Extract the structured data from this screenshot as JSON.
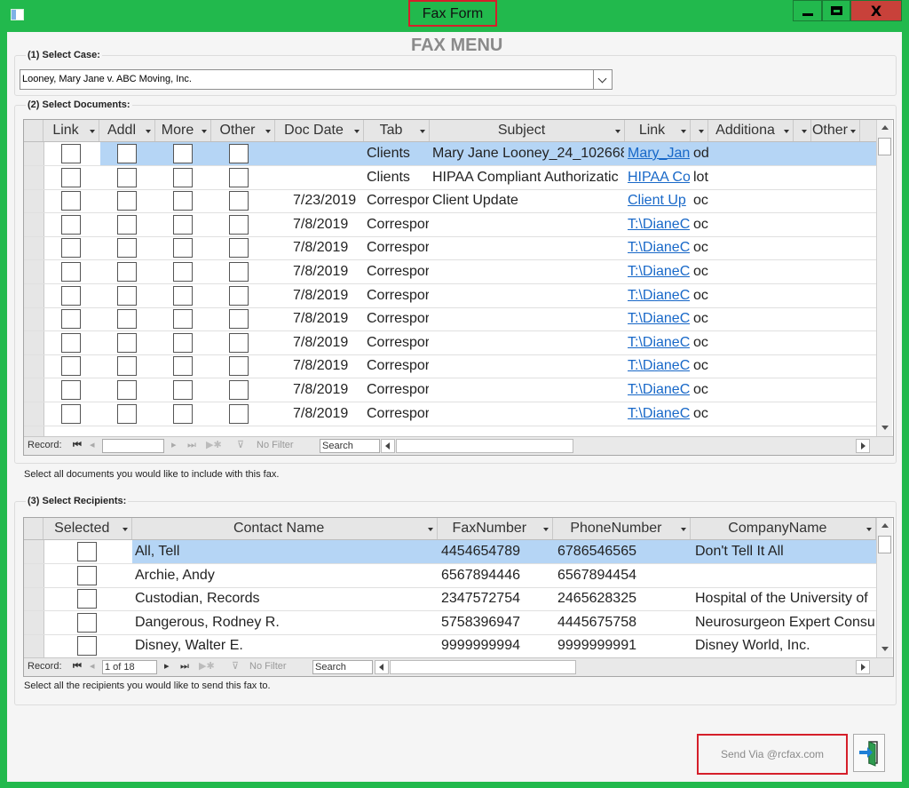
{
  "window": {
    "title": "Fax Form",
    "close_glyph": "X"
  },
  "form": {
    "heading": "FAX MENU"
  },
  "case": {
    "label": "(1) Select Case:",
    "value": "Looney, Mary Jane v. ABC Moving, Inc."
  },
  "documents": {
    "label": "(2) Select Documents:",
    "columns": [
      "Link",
      "Addl",
      "More",
      "Other",
      "Doc Date",
      "Tab",
      "Subject",
      "Link",
      "",
      "Additiona",
      "",
      "Other"
    ],
    "rows": [
      {
        "date": "",
        "tab": "Clients",
        "subject": "Mary  Jane Looney_24_102668",
        "link": "Mary_Jan",
        "extra": "od"
      },
      {
        "date": "",
        "tab": "Clients",
        "subject": "HIPAA Compliant Authorizatic",
        "link": "HIPAA Co",
        "extra": "lot"
      },
      {
        "date": "7/23/2019",
        "tab": "Correspor",
        "subject": "Client Update",
        "link": "Client Up",
        "extra": "oc"
      },
      {
        "date": "7/8/2019",
        "tab": "Correspor",
        "subject": "",
        "link": "T:\\DianeC",
        "extra": "oc"
      },
      {
        "date": "7/8/2019",
        "tab": "Correspor",
        "subject": "",
        "link": "T:\\DianeC",
        "extra": "oc"
      },
      {
        "date": "7/8/2019",
        "tab": "Correspor",
        "subject": "",
        "link": "T:\\DianeC",
        "extra": "oc"
      },
      {
        "date": "7/8/2019",
        "tab": "Correspor",
        "subject": "",
        "link": "T:\\DianeC",
        "extra": "oc"
      },
      {
        "date": "7/8/2019",
        "tab": "Correspor",
        "subject": "",
        "link": "T:\\DianeC",
        "extra": "oc"
      },
      {
        "date": "7/8/2019",
        "tab": "Correspor",
        "subject": "",
        "link": "T:\\DianeC",
        "extra": "oc"
      },
      {
        "date": "7/8/2019",
        "tab": "Correspor",
        "subject": "",
        "link": "T:\\DianeC",
        "extra": "oc"
      },
      {
        "date": "7/8/2019",
        "tab": "Correspor",
        "subject": "",
        "link": "T:\\DianeC",
        "extra": "oc"
      },
      {
        "date": "7/8/2019",
        "tab": "Correspor",
        "subject": "",
        "link": "T:\\DianeC",
        "extra": "oc"
      }
    ],
    "nav": {
      "record_label": "Record:",
      "position": "",
      "filter": "No Filter",
      "search": "Search"
    },
    "note": "Select all documents you would like to include with this fax."
  },
  "recipients": {
    "label": "(3) Select Recipients:",
    "columns": [
      "Selected",
      "Contact Name",
      "FaxNumber",
      "PhoneNumber",
      "CompanyName"
    ],
    "rows": [
      {
        "name": "All, Tell",
        "fax": "4454654789",
        "phone": "6786546565",
        "company": "Don't Tell It All"
      },
      {
        "name": "Archie, Andy",
        "fax": "6567894446",
        "phone": "6567894454",
        "company": ""
      },
      {
        "name": "Custodian, Records",
        "fax": "2347572754",
        "phone": "2465628325",
        "company": "Hospital of the University of"
      },
      {
        "name": "Dangerous, Rodney R.",
        "fax": "5758396947",
        "phone": "4445675758",
        "company": "Neurosurgeon Expert Consu"
      },
      {
        "name": "Disney, Walter E.",
        "fax": "9999999994",
        "phone": "9999999991",
        "company": "Disney World, Inc."
      }
    ],
    "nav": {
      "record_label": "Record:",
      "position": "1 of 18",
      "filter": "No Filter",
      "search": "Search"
    },
    "note": "Select all the recipients you would like to send this fax to."
  },
  "actions": {
    "send_label": "Send Via @rcfax.com",
    "exit_icon": "exit-door-icon"
  },
  "colors": {
    "window_frame": "#22b94d",
    "highlight_border": "#d51f2a",
    "selected_row": "#b5d5f5",
    "link": "#1868c8",
    "close_button": "#c8413a"
  }
}
